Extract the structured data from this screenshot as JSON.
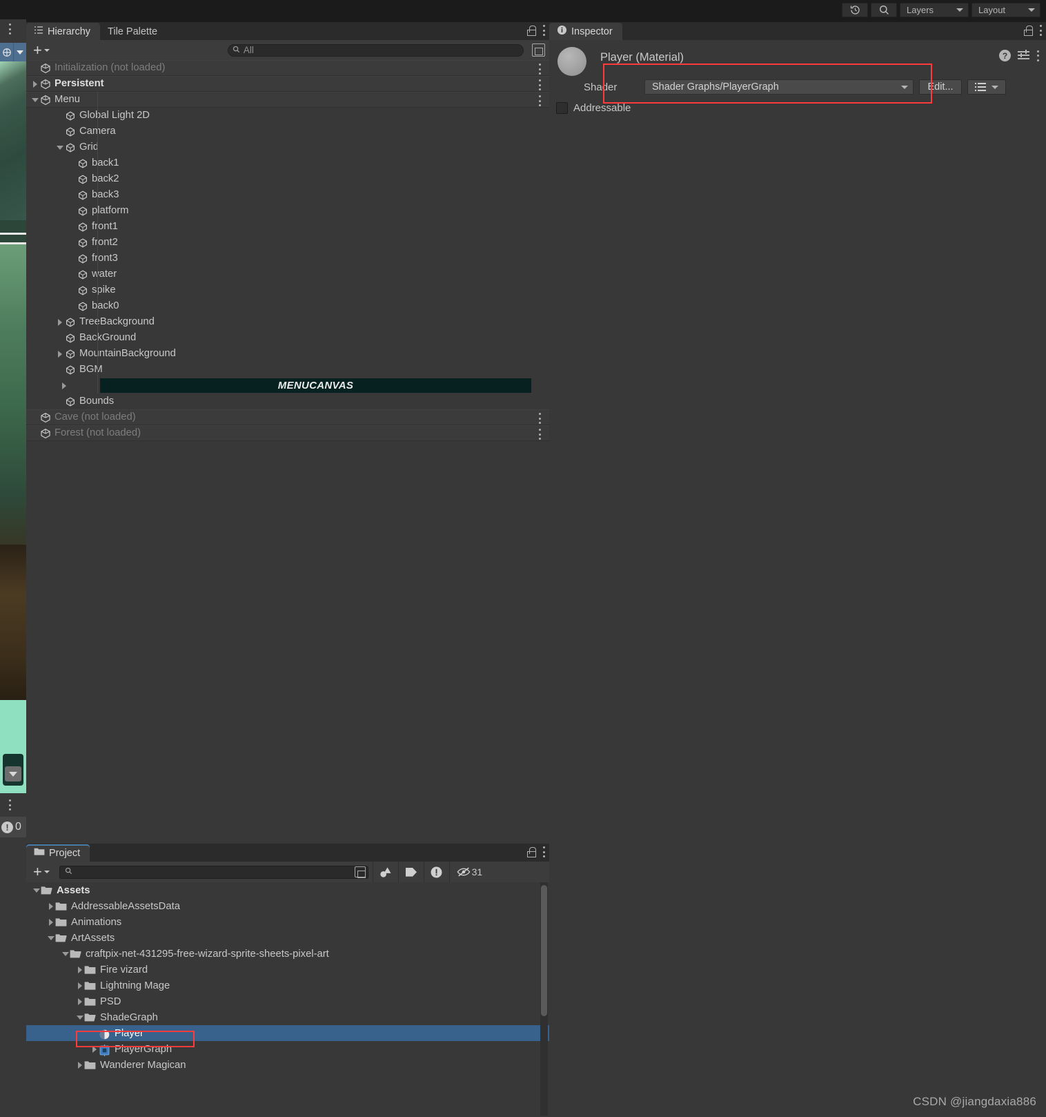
{
  "toolbar": {
    "history_icon": "history-icon",
    "search_icon": "search-icon",
    "layers_label": "Layers",
    "layout_label": "Layout"
  },
  "hierarchy": {
    "tabs": [
      {
        "label": "Hierarchy",
        "active": true,
        "icon": "hierarchy-icon"
      },
      {
        "label": "Tile Palette",
        "active": false
      }
    ],
    "add_label": "+",
    "search_placeholder": "All",
    "items": [
      {
        "label": "Initialization (not loaded)",
        "indent": 0,
        "kind": "scene",
        "arrow": "none",
        "dim": true
      },
      {
        "label": "Persistent",
        "indent": 0,
        "kind": "scene",
        "arrow": "right",
        "bold": true
      },
      {
        "label": "Menu",
        "indent": 0,
        "kind": "scene",
        "arrow": "down",
        "bold": false
      },
      {
        "label": "Global Light 2D",
        "indent": 2,
        "kind": "go",
        "arrow": "none"
      },
      {
        "label": "Camera",
        "indent": 2,
        "kind": "go",
        "arrow": "none"
      },
      {
        "label": "Grid",
        "indent": 2,
        "kind": "go",
        "arrow": "down"
      },
      {
        "label": "back1",
        "indent": 3,
        "kind": "go",
        "arrow": "none"
      },
      {
        "label": "back2",
        "indent": 3,
        "kind": "go",
        "arrow": "none"
      },
      {
        "label": "back3",
        "indent": 3,
        "kind": "go",
        "arrow": "none"
      },
      {
        "label": "platform",
        "indent": 3,
        "kind": "go",
        "arrow": "none"
      },
      {
        "label": "front1",
        "indent": 3,
        "kind": "go",
        "arrow": "none"
      },
      {
        "label": "front2",
        "indent": 3,
        "kind": "go",
        "arrow": "none"
      },
      {
        "label": "front3",
        "indent": 3,
        "kind": "go",
        "arrow": "none"
      },
      {
        "label": "water",
        "indent": 3,
        "kind": "go",
        "arrow": "none"
      },
      {
        "label": "spike",
        "indent": 3,
        "kind": "go",
        "arrow": "none"
      },
      {
        "label": "back0",
        "indent": 3,
        "kind": "go",
        "arrow": "none"
      },
      {
        "label": "TreeBackground",
        "indent": 2,
        "kind": "go",
        "arrow": "right"
      },
      {
        "label": "BackGround",
        "indent": 2,
        "kind": "go",
        "arrow": "none"
      },
      {
        "label": "MountainBackground",
        "indent": 2,
        "kind": "go",
        "arrow": "right"
      },
      {
        "label": "BGM",
        "indent": 2,
        "kind": "go",
        "arrow": "none"
      },
      {
        "label": "MENUCANVAS",
        "indent": 2,
        "kind": "canvas",
        "arrow": "right"
      },
      {
        "label": "Bounds",
        "indent": 2,
        "kind": "go",
        "arrow": "none"
      },
      {
        "label": "Cave (not loaded)",
        "indent": 0,
        "kind": "scene",
        "arrow": "none",
        "dim": true
      },
      {
        "label": "Forest (not loaded)",
        "indent": 0,
        "kind": "scene",
        "arrow": "none",
        "dim": true
      }
    ]
  },
  "inspector": {
    "tab_label": "Inspector",
    "tab_icon": "info-icon",
    "material_title": "Player (Material)",
    "help_icon": "help-icon",
    "preset_icon": "preset-icon",
    "menu_icon": "kebab-icon",
    "shader_label": "Shader",
    "shader_value": "Shader Graphs/PlayerGraph",
    "edit_label": "Edit...",
    "addressable_label": "Addressable",
    "addressable_checked": false,
    "highlight_color": "#ff3b3b"
  },
  "project": {
    "tab_label": "Project",
    "tab_icon": "folder-icon",
    "add_label": "+",
    "search_placeholder": "",
    "filter_icons": [
      "shape-filter-icon",
      "label-filter-icon",
      "warning-filter-icon"
    ],
    "hidden_count": "31",
    "hidden_icon": "eye-slash-icon",
    "items": [
      {
        "label": "Assets",
        "indent": 0,
        "arrow": "down",
        "icon": "folder-open",
        "bold": true
      },
      {
        "label": "AddressableAssetsData",
        "indent": 1,
        "arrow": "right",
        "icon": "folder"
      },
      {
        "label": "Animations",
        "indent": 1,
        "arrow": "right",
        "icon": "folder"
      },
      {
        "label": "ArtAssets",
        "indent": 1,
        "arrow": "down",
        "icon": "folder-open"
      },
      {
        "label": "craftpix-net-431295-free-wizard-sprite-sheets-pixel-art",
        "indent": 2,
        "arrow": "down",
        "icon": "folder-open"
      },
      {
        "label": "Fire vizard",
        "indent": 3,
        "arrow": "right",
        "icon": "folder"
      },
      {
        "label": "Lightning Mage",
        "indent": 3,
        "arrow": "right",
        "icon": "folder"
      },
      {
        "label": "PSD",
        "indent": 3,
        "arrow": "right",
        "icon": "folder"
      },
      {
        "label": "ShadeGraph",
        "indent": 3,
        "arrow": "down",
        "icon": "folder-open"
      },
      {
        "label": "Player",
        "indent": 4,
        "arrow": "none",
        "icon": "material",
        "selected": true
      },
      {
        "label": "PlayerGraph",
        "indent": 4,
        "arrow": "right",
        "icon": "shadergraph"
      },
      {
        "label": "Wanderer Magican",
        "indent": 3,
        "arrow": "right",
        "icon": "folder"
      }
    ]
  },
  "status": {
    "warning_count": "0",
    "warning_icon": "warning-icon"
  },
  "watermark": "CSDN @jiangdaxia886"
}
